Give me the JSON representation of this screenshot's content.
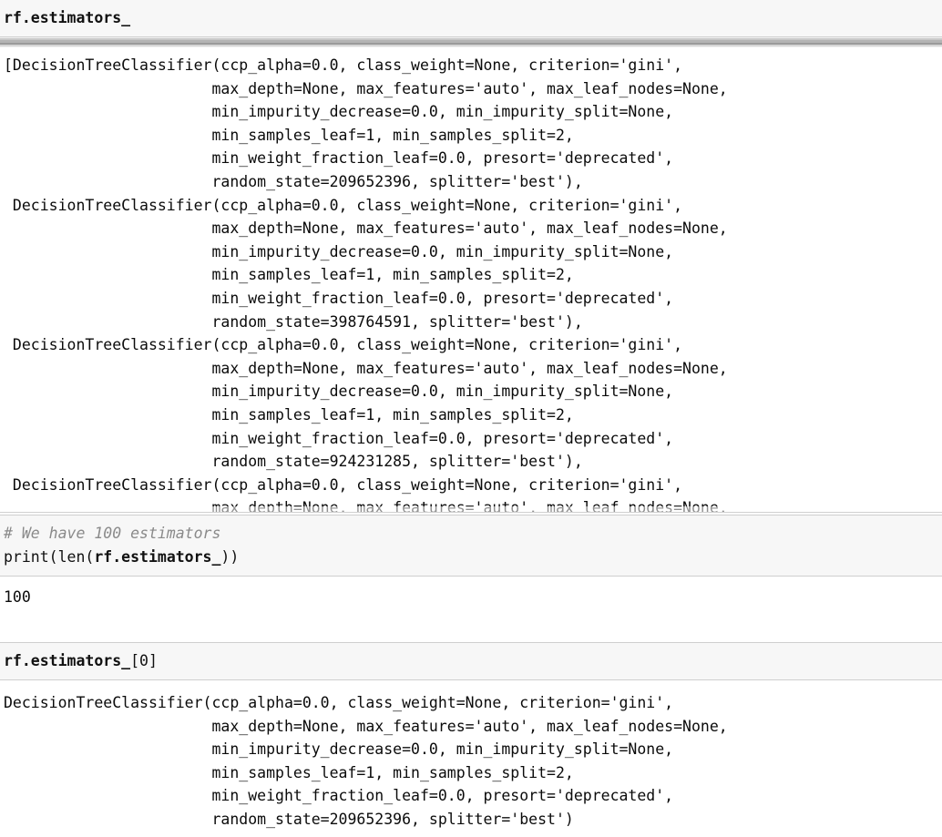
{
  "notebook": {
    "cells": [
      {
        "id": "cell-1",
        "type": "input",
        "lines": [
          {
            "bold": "rf.estimators_",
            "plain": ""
          }
        ]
      },
      {
        "id": "cell-1-output",
        "type": "output-scrolled",
        "lines": [
          "[DecisionTreeClassifier(ccp_alpha=0.0, class_weight=None, criterion='gini',",
          "                       max_depth=None, max_features='auto', max_leaf_nodes=None,",
          "                       min_impurity_decrease=0.0, min_impurity_split=None,",
          "                       min_samples_leaf=1, min_samples_split=2,",
          "                       min_weight_fraction_leaf=0.0, presort='deprecated',",
          "                       random_state=209652396, splitter='best'),",
          " DecisionTreeClassifier(ccp_alpha=0.0, class_weight=None, criterion='gini',",
          "                       max_depth=None, max_features='auto', max_leaf_nodes=None,",
          "                       min_impurity_decrease=0.0, min_impurity_split=None,",
          "                       min_samples_leaf=1, min_samples_split=2,",
          "                       min_weight_fraction_leaf=0.0, presort='deprecated',",
          "                       random_state=398764591, splitter='best'),",
          " DecisionTreeClassifier(ccp_alpha=0.0, class_weight=None, criterion='gini',",
          "                       max_depth=None, max_features='auto', max_leaf_nodes=None,",
          "                       min_impurity_decrease=0.0, min_impurity_split=None,",
          "                       min_samples_leaf=1, min_samples_split=2,",
          "                       min_weight_fraction_leaf=0.0, presort='deprecated',",
          "                       random_state=924231285, splitter='best'),",
          " DecisionTreeClassifier(ccp_alpha=0.0, class_weight=None, criterion='gini',",
          "                       max_depth=None, max_features='auto', max_leaf_nodes=None,"
        ]
      },
      {
        "id": "cell-2",
        "type": "input",
        "lines": [
          {
            "comment": "# We have 100 estimators"
          },
          {
            "prefix": "print(len(",
            "bold": "rf.estimators_",
            "suffix": "))"
          }
        ]
      },
      {
        "id": "cell-2-output",
        "type": "output",
        "lines": [
          "100"
        ]
      },
      {
        "id": "cell-3",
        "type": "input",
        "lines": [
          {
            "bold": "rf.estimators_",
            "plain": "[0]"
          }
        ]
      },
      {
        "id": "cell-3-output",
        "type": "output",
        "lines": [
          "DecisionTreeClassifier(ccp_alpha=0.0, class_weight=None, criterion='gini',",
          "                       max_depth=None, max_features='auto', max_leaf_nodes=None,",
          "                       min_impurity_decrease=0.0, min_impurity_split=None,",
          "                       min_samples_leaf=1, min_samples_split=2,",
          "                       min_weight_fraction_leaf=0.0, presort='deprecated',",
          "                       random_state=209652396, splitter='best')"
        ]
      }
    ]
  },
  "cell1": {
    "code_bold": "rf.estimators_"
  },
  "cell1_output": {
    "line_0": "[DecisionTreeClassifier(ccp_alpha=0.0, class_weight=None, criterion='gini',",
    "line_1": "                       max_depth=None, max_features='auto', max_leaf_nodes=None,",
    "line_2": "                       min_impurity_decrease=0.0, min_impurity_split=None,",
    "line_3": "                       min_samples_leaf=1, min_samples_split=2,",
    "line_4": "                       min_weight_fraction_leaf=0.0, presort='deprecated',",
    "line_5": "                       random_state=209652396, splitter='best'),",
    "line_6": " DecisionTreeClassifier(ccp_alpha=0.0, class_weight=None, criterion='gini',",
    "line_7": "                       max_depth=None, max_features='auto', max_leaf_nodes=None,",
    "line_8": "                       min_impurity_decrease=0.0, min_impurity_split=None,",
    "line_9": "                       min_samples_leaf=1, min_samples_split=2,",
    "line_10": "                       min_weight_fraction_leaf=0.0, presort='deprecated',",
    "line_11": "                       random_state=398764591, splitter='best'),",
    "line_12": " DecisionTreeClassifier(ccp_alpha=0.0, class_weight=None, criterion='gini',",
    "line_13": "                       max_depth=None, max_features='auto', max_leaf_nodes=None,",
    "line_14": "                       min_impurity_decrease=0.0, min_impurity_split=None,",
    "line_15": "                       min_samples_leaf=1, min_samples_split=2,",
    "line_16": "                       min_weight_fraction_leaf=0.0, presort='deprecated',",
    "line_17": "                       random_state=924231285, splitter='best'),",
    "line_18": " DecisionTreeClassifier(ccp_alpha=0.0, class_weight=None, criterion='gini',",
    "line_19": "                       max_depth=None, max_features='auto', max_leaf_nodes=None,"
  },
  "cell2": {
    "comment": "# We have 100 estimators",
    "print_prefix": "print(len(",
    "print_bold": "rf.estimators_",
    "print_suffix": "))"
  },
  "cell2_output": {
    "line_0": "100"
  },
  "cell3": {
    "code_bold": "rf.estimators_",
    "code_plain": "[0]"
  },
  "cell3_output": {
    "line_0": "DecisionTreeClassifier(ccp_alpha=0.0, class_weight=None, criterion='gini',",
    "line_1": "                       max_depth=None, max_features='auto', max_leaf_nodes=None,",
    "line_2": "                       min_impurity_decrease=0.0, min_impurity_split=None,",
    "line_3": "                       min_samples_leaf=1, min_samples_split=2,",
    "line_4": "                       min_weight_fraction_leaf=0.0, presort='deprecated',",
    "line_5": "                       random_state=209652396, splitter='best')"
  },
  "colors": {
    "input_cell_background": "#f7f7f7",
    "output_background": "#ffffff",
    "text": "#111111",
    "comment": "#8a8a8a",
    "border": "#cfcfcf",
    "scrollbar": "#9a9a9a"
  }
}
